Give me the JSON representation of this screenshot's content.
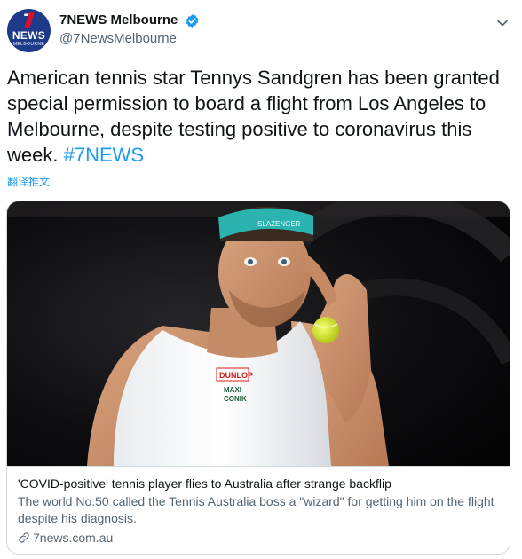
{
  "account": {
    "display_name": "7NEWS Melbourne",
    "handle": "@7NewsMelbourne",
    "avatar_number": "7",
    "avatar_brand": "NEWS",
    "avatar_city": "MELBOURNE",
    "verified": true
  },
  "tweet": {
    "text": "American tennis star Tennys Sandgren has been granted special permission to board a flight from Los Angeles to Melbourne, despite testing positive to coronavirus this week. ",
    "hashtag": "#7NEWS",
    "translate_label": "翻译推文"
  },
  "card": {
    "image_alt": "Tennis player wearing teal headband, holding a tennis ball",
    "title": "'COVID-positive' tennis player flies to Australia after strange backflip",
    "description": "The world No.50 called the Tennis Australia boss a \"wizard\" for getting him on the flight despite his diagnosis.",
    "domain": "7news.com.au",
    "sponsor_lines": [
      "DUNLOP",
      "MAXI",
      "CONIK"
    ],
    "headband_text": "SLAZENGER"
  },
  "icons": {
    "verified": "verified-badge-icon",
    "more": "chevron-down-icon",
    "link": "link-icon"
  },
  "colors": {
    "accent": "#1d9bf0",
    "avatar_bg": "#1e3a8a",
    "avatar_red": "#d6112b",
    "headband": "#2bb3b0"
  }
}
